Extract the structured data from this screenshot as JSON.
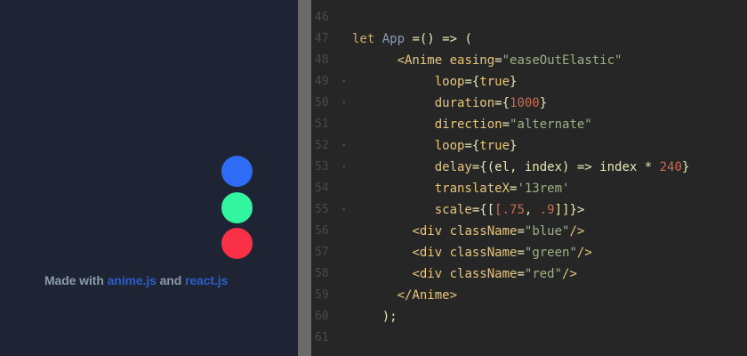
{
  "preview": {
    "credit_prefix": "Made with ",
    "credit_link1": "anime.js",
    "credit_middle": " and ",
    "credit_link2": "react.js",
    "dots": [
      {
        "name": "blue",
        "color": "#2f6cf6"
      },
      {
        "name": "green",
        "color": "#32f5a0"
      },
      {
        "name": "red",
        "color": "#fa3046"
      }
    ]
  },
  "editor": {
    "lines": [
      {
        "num": "46",
        "fold": false,
        "tokens": []
      },
      {
        "num": "47",
        "fold": false,
        "tokens": [
          [
            "kw",
            "let "
          ],
          [
            "fn",
            "App"
          ],
          [
            "pl",
            " =() => ("
          ]
        ]
      },
      {
        "num": "48",
        "fold": false,
        "tokens": [
          [
            "pl",
            "      "
          ],
          [
            "tag",
            "<Anime "
          ],
          [
            "at",
            "easing"
          ],
          [
            "pl",
            "="
          ],
          [
            "str",
            "\"easeOutElastic\""
          ]
        ]
      },
      {
        "num": "49",
        "fold": true,
        "tokens": [
          [
            "pl",
            "           "
          ],
          [
            "at",
            "loop"
          ],
          [
            "pl",
            "={"
          ],
          [
            "at",
            "true"
          ],
          [
            "pl",
            "}"
          ]
        ]
      },
      {
        "num": "50",
        "fold": true,
        "tokens": [
          [
            "pl",
            "           "
          ],
          [
            "at",
            "duration"
          ],
          [
            "pl",
            "={"
          ],
          [
            "num",
            "1000"
          ],
          [
            "pl",
            "}"
          ]
        ]
      },
      {
        "num": "51",
        "fold": false,
        "tokens": [
          [
            "pl",
            "           "
          ],
          [
            "at",
            "direction"
          ],
          [
            "pl",
            "="
          ],
          [
            "str",
            "\"alternate\""
          ]
        ]
      },
      {
        "num": "52",
        "fold": true,
        "tokens": [
          [
            "pl",
            "           "
          ],
          [
            "at",
            "loop"
          ],
          [
            "pl",
            "={"
          ],
          [
            "at",
            "true"
          ],
          [
            "pl",
            "}"
          ]
        ]
      },
      {
        "num": "53",
        "fold": true,
        "tokens": [
          [
            "pl",
            "           "
          ],
          [
            "at",
            "delay"
          ],
          [
            "pl",
            "={(el, index) => index * "
          ],
          [
            "num",
            "240"
          ],
          [
            "pl",
            "}"
          ]
        ]
      },
      {
        "num": "54",
        "fold": false,
        "tokens": [
          [
            "pl",
            "           "
          ],
          [
            "at",
            "translateX"
          ],
          [
            "pl",
            "="
          ],
          [
            "str",
            "'13rem'"
          ]
        ]
      },
      {
        "num": "55",
        "fold": true,
        "tokens": [
          [
            "pl",
            "           "
          ],
          [
            "at",
            "scale"
          ],
          [
            "pl",
            "={["
          ],
          [
            "num",
            "[.75"
          ],
          [
            "pl",
            ", "
          ],
          [
            "num",
            ".9"
          ],
          [
            "pl",
            "]]}>"
          ]
        ]
      },
      {
        "num": "56",
        "fold": false,
        "tokens": [
          [
            "pl",
            "        "
          ],
          [
            "tag",
            "<div "
          ],
          [
            "at",
            "className"
          ],
          [
            "pl",
            "="
          ],
          [
            "str",
            "\"blue\""
          ],
          [
            "tag",
            "/>"
          ]
        ]
      },
      {
        "num": "57",
        "fold": false,
        "tokens": [
          [
            "pl",
            "        "
          ],
          [
            "tag",
            "<div "
          ],
          [
            "at",
            "className"
          ],
          [
            "pl",
            "="
          ],
          [
            "str",
            "\"green\""
          ],
          [
            "tag",
            "/>"
          ]
        ]
      },
      {
        "num": "58",
        "fold": false,
        "tokens": [
          [
            "pl",
            "        "
          ],
          [
            "tag",
            "<div "
          ],
          [
            "at",
            "className"
          ],
          [
            "pl",
            "="
          ],
          [
            "str",
            "\"red\""
          ],
          [
            "tag",
            "/>"
          ]
        ]
      },
      {
        "num": "59",
        "fold": false,
        "tokens": [
          [
            "pl",
            "      "
          ],
          [
            "tag",
            "</Anime>"
          ]
        ]
      },
      {
        "num": "60",
        "fold": false,
        "tokens": [
          [
            "pl",
            "    );"
          ]
        ]
      },
      {
        "num": "61",
        "fold": false,
        "tokens": []
      }
    ]
  }
}
